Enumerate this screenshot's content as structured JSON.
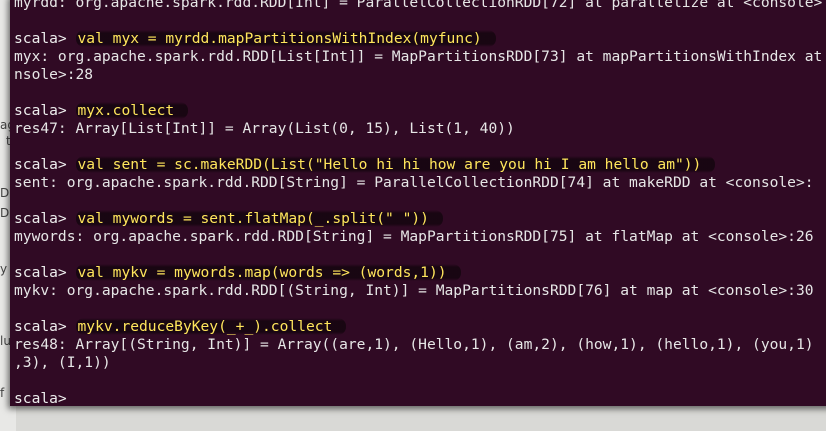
{
  "behind_window": {
    "fragments": [
      "ag",
      "t",
      "DD",
      "DD",
      "y",
      "lu",
      "f"
    ]
  },
  "terminal": {
    "prompt": "scala>",
    "lines": [
      {
        "kind": "output",
        "text": "myrdd: org.apache.spark.rdd.RDD[Int] = ParallelCollectionRDD[72] at parallelize at <console>"
      },
      {
        "kind": "blank",
        "text": ""
      },
      {
        "kind": "command",
        "text": "val myx = myrdd.mapPartitionsWithIndex(myfunc)"
      },
      {
        "kind": "output",
        "text": "myx: org.apache.spark.rdd.RDD[List[Int]] = MapPartitionsRDD[73] at mapPartitionsWithIndex at"
      },
      {
        "kind": "output",
        "text": "nsole>:28"
      },
      {
        "kind": "blank",
        "text": ""
      },
      {
        "kind": "command",
        "text": "myx.collect"
      },
      {
        "kind": "output",
        "text": "res47: Array[List[Int]] = Array(List(0, 15), List(1, 40))"
      },
      {
        "kind": "blank",
        "text": ""
      },
      {
        "kind": "command",
        "text": "val sent = sc.makeRDD(List(\"Hello hi hi how are you hi I am hello am\"))"
      },
      {
        "kind": "output",
        "text": "sent: org.apache.spark.rdd.RDD[String] = ParallelCollectionRDD[74] at makeRDD at <console>:"
      },
      {
        "kind": "blank",
        "text": ""
      },
      {
        "kind": "command",
        "text": "val mywords = sent.flatMap(_.split(\" \"))"
      },
      {
        "kind": "output",
        "text": "mywords: org.apache.spark.rdd.RDD[String] = MapPartitionsRDD[75] at flatMap at <console>:26"
      },
      {
        "kind": "blank",
        "text": ""
      },
      {
        "kind": "command",
        "text": "val mykv = mywords.map(words => (words,1))"
      },
      {
        "kind": "output",
        "text": "mykv: org.apache.spark.rdd.RDD[(String, Int)] = MapPartitionsRDD[76] at map at <console>:30"
      },
      {
        "kind": "blank",
        "text": ""
      },
      {
        "kind": "command",
        "text": "mykv.reduceByKey(_+_).collect"
      },
      {
        "kind": "output",
        "text": "res48: Array[(String, Int)] = Array((are,1), (Hello,1), (am,2), (how,1), (hello,1), (you,1)"
      },
      {
        "kind": "output",
        "text": ",3), (I,1))"
      },
      {
        "kind": "blank",
        "text": ""
      },
      {
        "kind": "prompt-only",
        "text": ""
      }
    ]
  },
  "colors": {
    "terminal_bg": "#300a24",
    "highlight_text": "#ffe65c",
    "output_text": "#e6e6e6"
  }
}
